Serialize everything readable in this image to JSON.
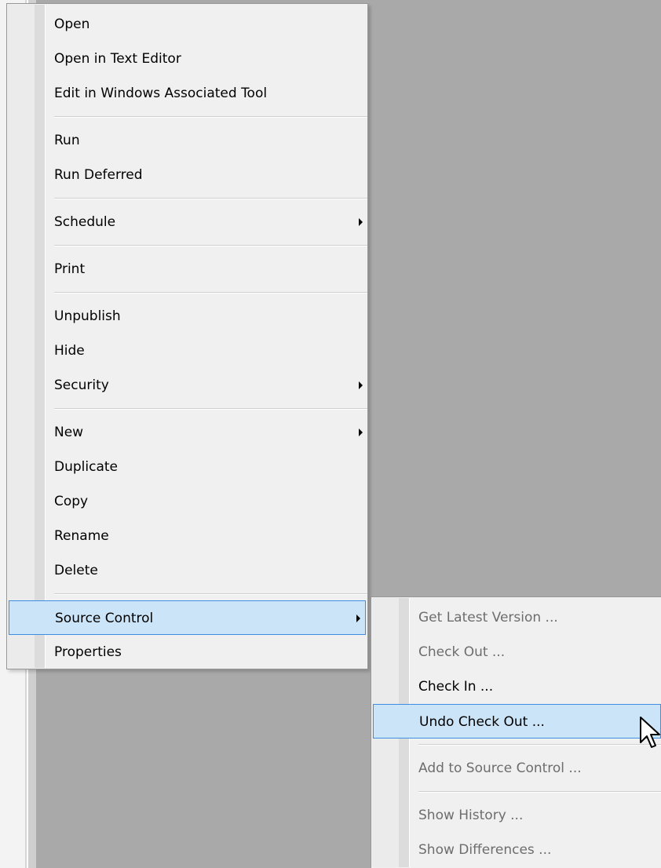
{
  "context_menu": {
    "items": [
      {
        "label": "Open"
      },
      {
        "label": "Open in Text Editor"
      },
      {
        "label": "Edit in Windows Associated Tool"
      },
      {
        "label": "Run"
      },
      {
        "label": "Run Deferred"
      },
      {
        "label": "Schedule",
        "has_submenu": true
      },
      {
        "label": "Print"
      },
      {
        "label": "Unpublish"
      },
      {
        "label": "Hide"
      },
      {
        "label": "Security",
        "has_submenu": true
      },
      {
        "label": "New",
        "has_submenu": true
      },
      {
        "label": "Duplicate"
      },
      {
        "label": "Copy"
      },
      {
        "label": "Rename"
      },
      {
        "label": "Delete"
      },
      {
        "label": "Source Control",
        "has_submenu": true,
        "highlighted": true
      },
      {
        "label": "Properties"
      }
    ]
  },
  "source_control_submenu": {
    "items": [
      {
        "label": "Get Latest Version ...",
        "enabled": false
      },
      {
        "label": "Check Out ...",
        "enabled": false
      },
      {
        "label": "Check In ...",
        "enabled": true
      },
      {
        "label": "Undo Check Out ...",
        "enabled": true,
        "highlighted": true
      },
      {
        "label": "Add to Source Control ...",
        "enabled": false
      },
      {
        "label": "Show History ...",
        "enabled": false
      },
      {
        "label": "Show Differences ...",
        "enabled": false
      }
    ]
  },
  "colors": {
    "menu_bg": "#f0f0f0",
    "highlight_bg": "#cce4f7",
    "highlight_border": "#3d8ee3",
    "disabled_text": "#6d6d6d",
    "background": "#a9a9a9"
  },
  "cursor": {
    "icon": "arrow-pointer-icon"
  }
}
